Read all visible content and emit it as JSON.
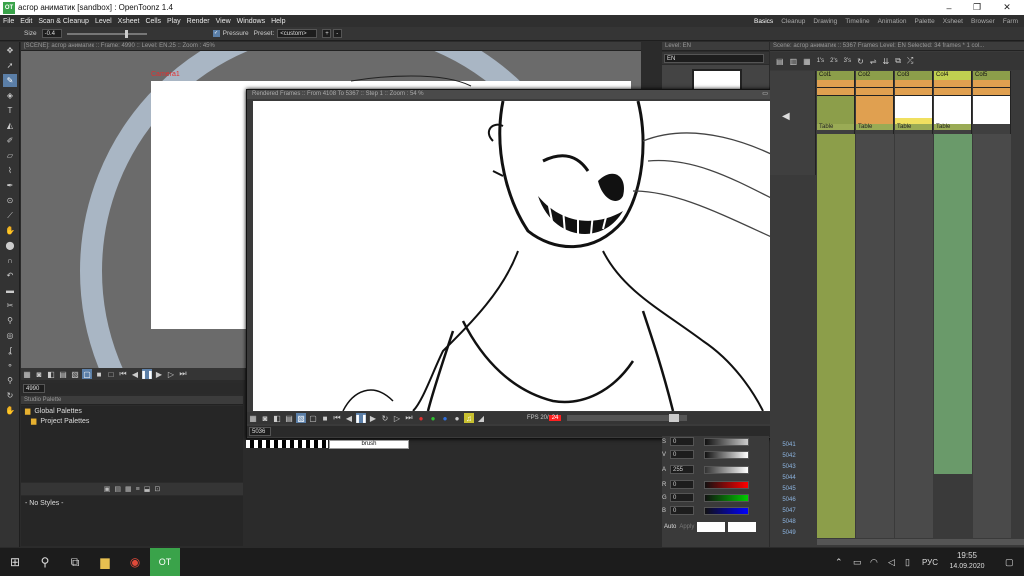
{
  "window": {
    "title": "асгор аниматик [sandbox] : OpenToonz 1.4",
    "app_icon": "OT"
  },
  "menu": [
    "File",
    "Edit",
    "Scan & Cleanup",
    "Level",
    "Xsheet",
    "Cells",
    "Play",
    "Render",
    "View",
    "Windows",
    "Help"
  ],
  "rooms": [
    "Basics",
    "Cleanup",
    "Drawing",
    "Timeline",
    "Animation",
    "Palette",
    "Xsheet",
    "Browser",
    "Farm"
  ],
  "tool_options": {
    "size_label": "Size",
    "size_value": "-0.4",
    "pressure_label": "Pressure",
    "preset_label": "Preset:",
    "preset_value": "<custom>"
  },
  "viewer": {
    "header": "[SCENE]: асгор аниматик  ::  Frame: 4990  ::  Level: EN.25  ::  Zoom : 45%",
    "camera_label": "Camera1",
    "frame_field": "4990"
  },
  "level_strip": {
    "header": "Level: EN",
    "field": "EN"
  },
  "rendered": {
    "header": "Rendered Frames  ::  From 4108 To 5367  ::  Step 1  ::  Zoom : 54 %",
    "frame_field": "5036",
    "fps_label": "FPS 20/",
    "fps_value": "24",
    "strip_text": "brush"
  },
  "palette": {
    "header": "Studio Palette",
    "items": [
      "Global Palettes",
      "Project Palettes"
    ],
    "no_styles": "- No Styles -"
  },
  "style_editor": {
    "rows": [
      {
        "k": "S",
        "v": "0"
      },
      {
        "k": "V",
        "v": "0"
      },
      {
        "k": "A",
        "v": "255"
      },
      {
        "k": "R",
        "v": "0"
      },
      {
        "k": "G",
        "v": "0"
      },
      {
        "k": "B",
        "v": "0"
      }
    ],
    "auto_label": "Auto",
    "apply_label": "Apply"
  },
  "xsheet": {
    "header": "Scene: асгор аниматик  ::  5367 Frames  Level: EN  Selected: 34 frames * 1 col...",
    "columns": [
      "Col1",
      "Col2",
      "Col3",
      "Col4",
      "Col5"
    ],
    "pegbar": [
      "Table",
      "Table",
      "Table",
      "Table"
    ],
    "frame_numbers": [
      "5041",
      "5042",
      "5043",
      "5044",
      "5045",
      "5046",
      "5047",
      "5048",
      "5049"
    ],
    "toolbar": [
      "1's",
      "2's",
      "3's"
    ]
  },
  "taskbar": {
    "time": "19:55",
    "date": "14.09.2020",
    "lang": "РУС"
  },
  "colors": {
    "accent": "#5b7fa8",
    "col_green": "#8c9e4a",
    "col_sel": "#c0cf50",
    "col_orange": "#e0a050",
    "red": "#ff2020"
  }
}
